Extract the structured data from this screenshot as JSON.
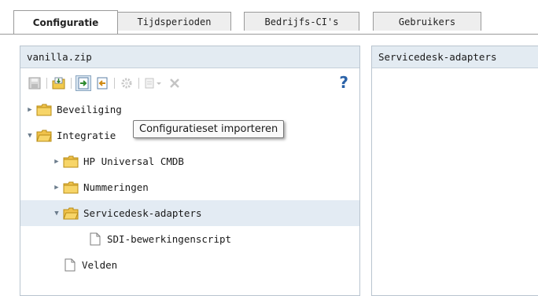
{
  "tabs": [
    {
      "label": "Configuratie",
      "active": true
    },
    {
      "label": "Tijdsperioden",
      "active": false
    },
    {
      "label": "Bedrijfs-CI's",
      "active": false
    },
    {
      "label": "Gebruikers",
      "active": false
    }
  ],
  "left_panel": {
    "title": "vanilla.zip",
    "toolbar": {
      "buttons": [
        {
          "icon": "save-icon"
        },
        {
          "icon": "export-config-icon"
        },
        {
          "icon": "import-config-icon",
          "hovered": true
        },
        {
          "icon": "restore-icon"
        },
        {
          "icon": "settings-icon",
          "disabled": true
        },
        {
          "icon": "add-icon",
          "disabled": true
        },
        {
          "icon": "delete-icon",
          "disabled": true
        },
        {
          "icon": "help-icon"
        }
      ],
      "help_glyph": "?"
    },
    "tree": [
      {
        "label": "Beveiliging",
        "type": "folder",
        "expanded": false,
        "level": 0
      },
      {
        "label": "Integratie",
        "type": "folder",
        "expanded": true,
        "level": 0
      },
      {
        "label": "HP Universal CMDB",
        "type": "folder",
        "expanded": false,
        "level": 1
      },
      {
        "label": "Nummeringen",
        "type": "folder",
        "expanded": false,
        "level": 1
      },
      {
        "label": "Servicedesk-adapters",
        "type": "folder",
        "expanded": true,
        "level": 1,
        "selected": true
      },
      {
        "label": "SDI-bewerkingenscript",
        "type": "document",
        "level": 2
      },
      {
        "label": "Velden",
        "type": "document",
        "level": 1
      }
    ]
  },
  "tooltip": {
    "text": "Configuratieset importeren"
  },
  "right_panel": {
    "title": "Servicedesk-adapters"
  }
}
